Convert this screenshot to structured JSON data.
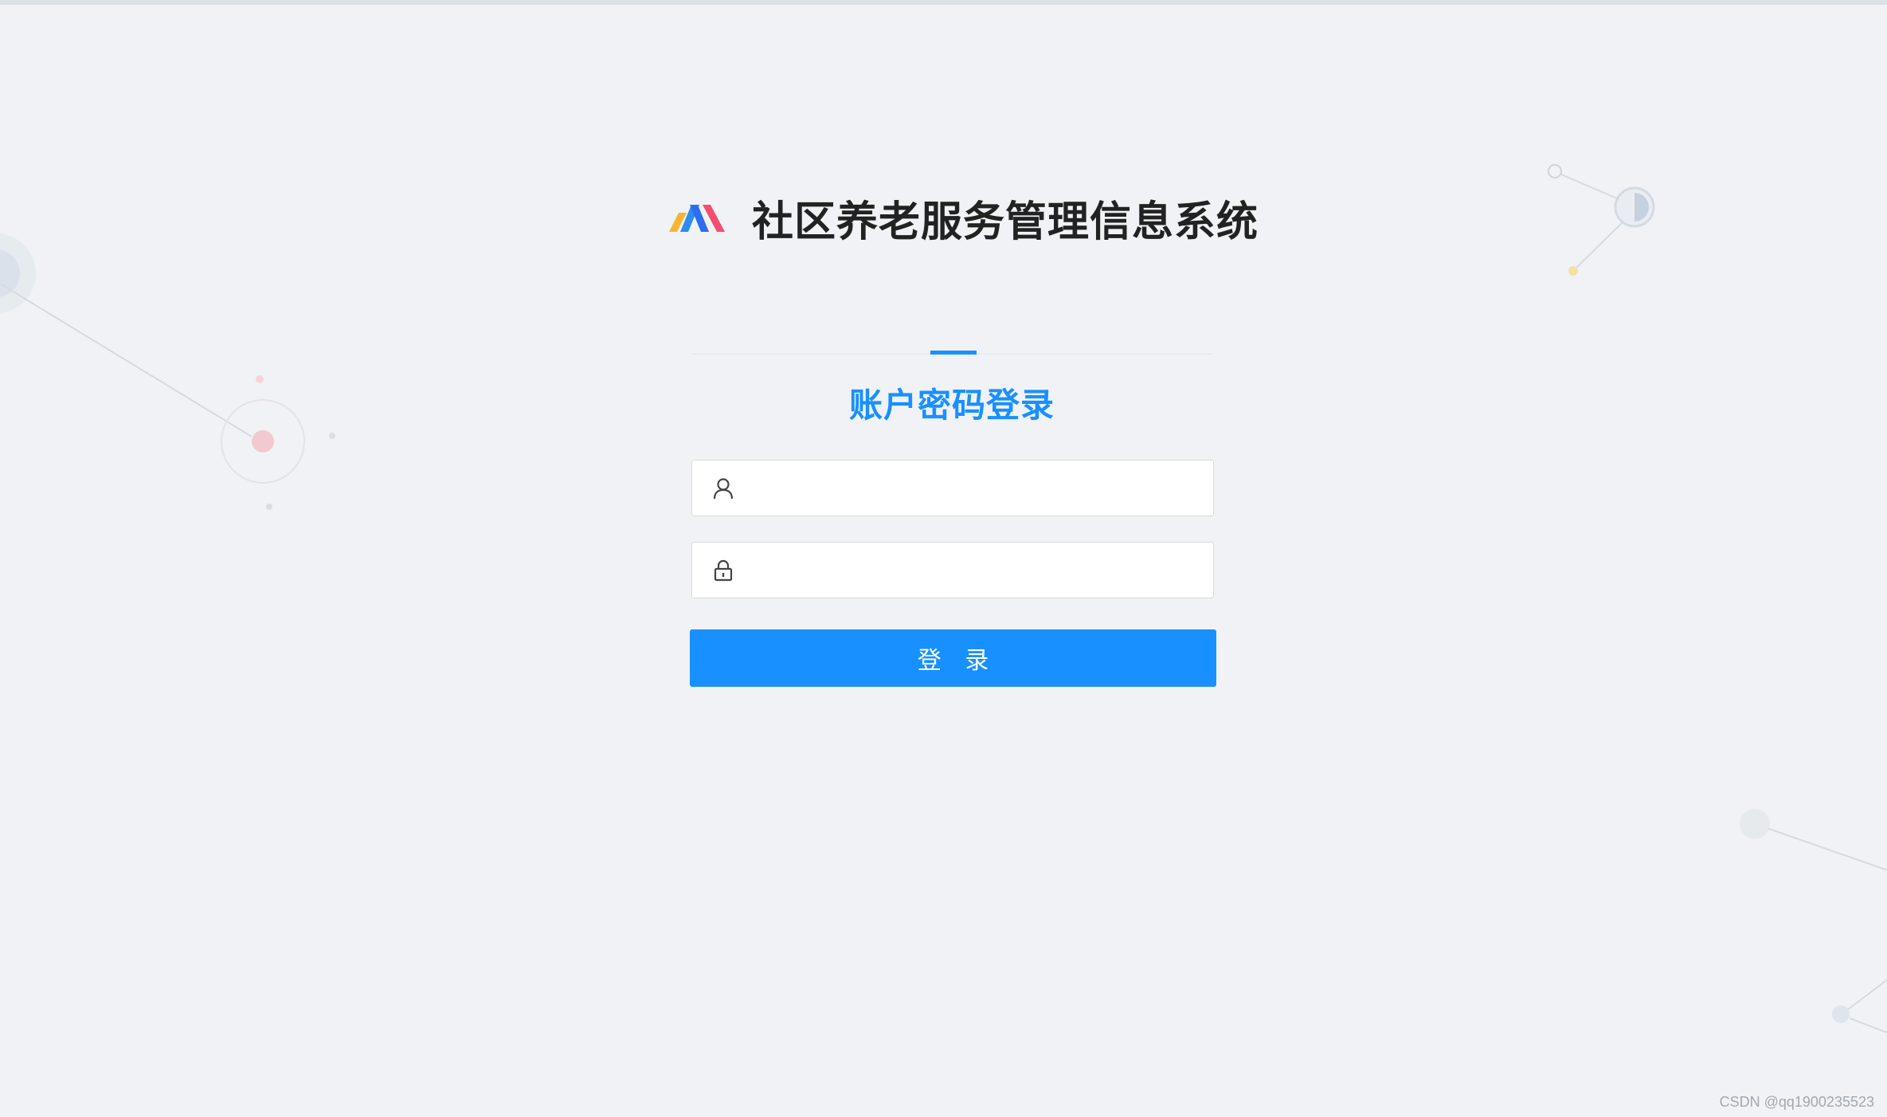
{
  "header": {
    "logo_icon": "app-logo",
    "title": "社区养老服务管理信息系统"
  },
  "login": {
    "tab_label": "账户密码登录",
    "username": {
      "value": "",
      "placeholder": "",
      "icon": "user-icon"
    },
    "password": {
      "value": "",
      "placeholder": "",
      "icon": "lock-icon"
    },
    "submit_label": "登 录"
  },
  "footer": {
    "watermark": "CSDN @qq1900235523"
  },
  "colors": {
    "background": "#f0f2f5",
    "primary": "#1890ff",
    "title_text": "#222222"
  }
}
